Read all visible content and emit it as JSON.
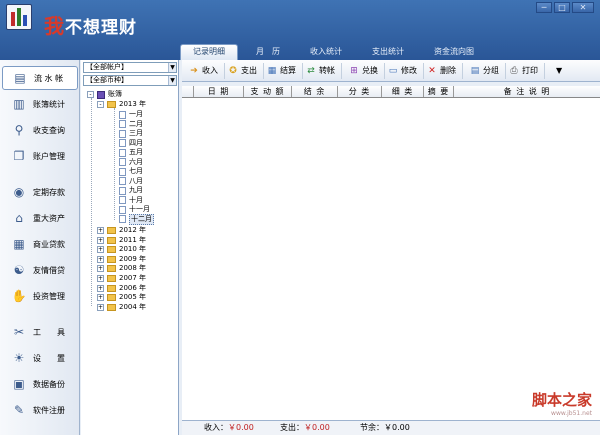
{
  "app": {
    "title_first": "我",
    "title_rest": "不想理财"
  },
  "window_buttons": [
    "─",
    "□",
    "✕"
  ],
  "tabs": [
    {
      "label": "记录明细",
      "active": true
    },
    {
      "label": "月　历",
      "active": false
    },
    {
      "label": "收入统计",
      "active": false
    },
    {
      "label": "支出统计",
      "active": false
    },
    {
      "label": "资金流向图",
      "active": false
    }
  ],
  "sidebar": {
    "items": [
      {
        "label": "流 水 帐",
        "icon": "wallet-icon",
        "glyph": "▤",
        "active": true
      },
      {
        "label": "账簿统计",
        "icon": "books-icon",
        "glyph": "▥"
      },
      {
        "label": "收支查询",
        "icon": "magnifier-icon",
        "glyph": "⚲"
      },
      {
        "label": "账户管理",
        "icon": "open-book-icon",
        "glyph": "❐"
      },
      {
        "label": "定期存款",
        "icon": "coins-icon",
        "glyph": "◉"
      },
      {
        "label": "重大资产",
        "icon": "house-icon",
        "glyph": "⌂"
      },
      {
        "label": "商业贷款",
        "icon": "building-icon",
        "glyph": "▦"
      },
      {
        "label": "友情借贷",
        "icon": "handshake-icon",
        "glyph": "☯"
      },
      {
        "label": "投资管理",
        "icon": "hand-money-icon",
        "glyph": "✋"
      },
      {
        "label": "工　　具",
        "icon": "tools-icon",
        "glyph": "✂"
      },
      {
        "label": "设　　置",
        "icon": "lightbulb-icon",
        "glyph": "☀"
      },
      {
        "label": "数据备份",
        "icon": "backup-icon",
        "glyph": "▣"
      },
      {
        "label": "软件注册",
        "icon": "register-icon",
        "glyph": "✎"
      }
    ]
  },
  "filters": {
    "account": "【全部帐户】",
    "currency": "【全部币种】"
  },
  "tree": {
    "root": "账簿",
    "year_open": "2013 年",
    "months": [
      "一月",
      "二月",
      "三月",
      "四月",
      "五月",
      "六月",
      "七月",
      "八月",
      "九月",
      "十月",
      "十一月",
      "十二月"
    ],
    "other_years": [
      "2012 年",
      "2011 年",
      "2010 年",
      "2009 年",
      "2008 年",
      "2007 年",
      "2006 年",
      "2005 年",
      "2004 年"
    ]
  },
  "toolbar": {
    "buttons": [
      {
        "label": "收入",
        "icon": "income-icon",
        "glyph": "➔",
        "color": "#d9901a"
      },
      {
        "label": "支出",
        "icon": "expense-icon",
        "glyph": "✪",
        "color": "#d9a01a"
      },
      {
        "label": "结算",
        "icon": "settle-icon",
        "glyph": "▦",
        "color": "#3f6fb5"
      },
      {
        "label": "转帐",
        "icon": "transfer-icon",
        "glyph": "⇄",
        "color": "#2b8a3e"
      },
      {
        "label": "兑换",
        "icon": "exchange-icon",
        "glyph": "⊞",
        "color": "#8b3fb0"
      },
      {
        "label": "修改",
        "icon": "edit-icon",
        "glyph": "▭",
        "color": "#3f6fb5"
      },
      {
        "label": "删除",
        "icon": "delete-icon",
        "glyph": "✕",
        "color": "#d02020"
      },
      {
        "label": "分组",
        "icon": "group-icon",
        "glyph": "▤",
        "color": "#3f6fb5"
      },
      {
        "label": "打印",
        "icon": "print-icon",
        "glyph": "⎙",
        "color": "#555555"
      }
    ],
    "more": "▼"
  },
  "grid": {
    "columns": [
      "日 期",
      "支 动 额",
      "结 余",
      "分 类",
      "细 类",
      "摘 要",
      "备 注 说 明"
    ]
  },
  "status": {
    "income_label": "收入：",
    "income_value": "￥0.00",
    "expense_label": "支出：",
    "expense_value": "￥0.00",
    "balance_label": "节余：",
    "balance_value": "￥0.00"
  },
  "watermark": {
    "text": "脚本之家",
    "url": "www.jb51.net"
  }
}
